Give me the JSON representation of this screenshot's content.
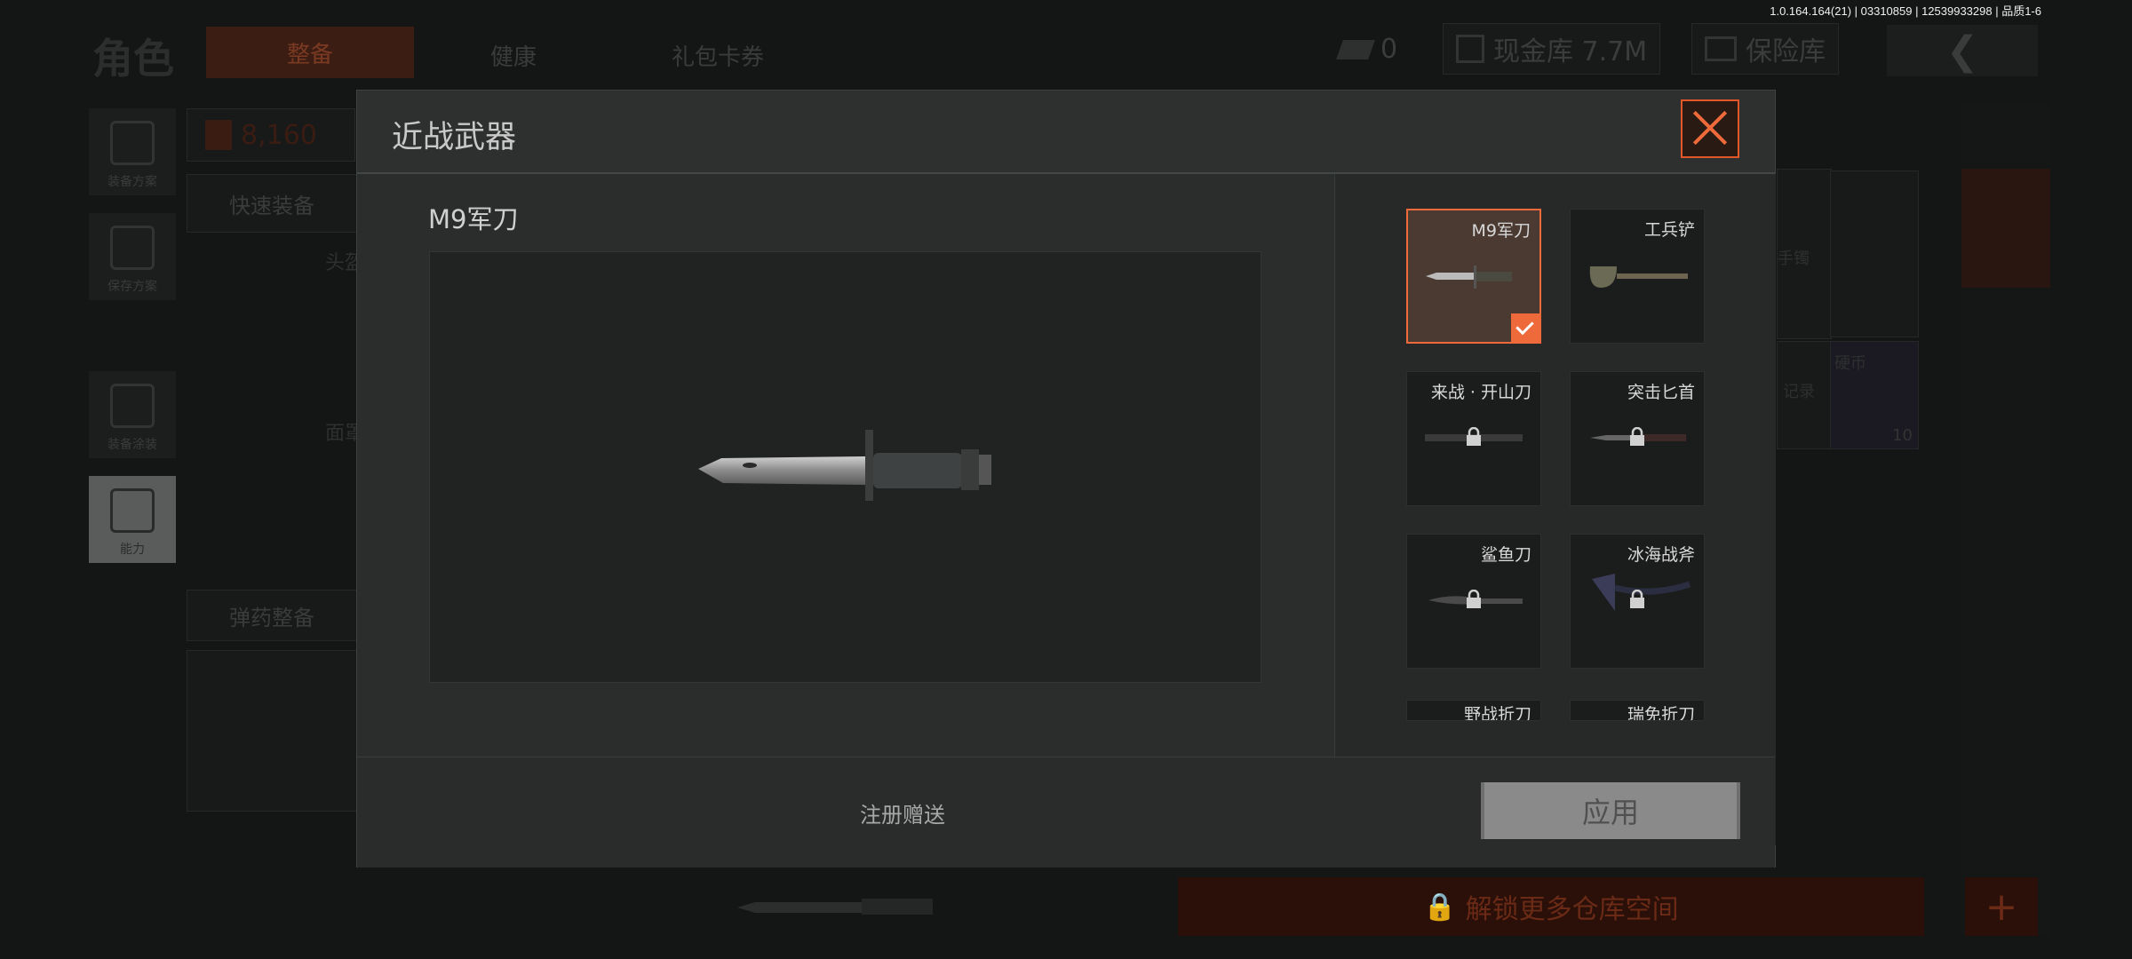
{
  "version": "1.0.164.164(21) | 03310859 | 12539933298 | 品质1-6",
  "background": {
    "title": "角色",
    "tabs": [
      "整备",
      "健康",
      "礼包卡券"
    ],
    "ticket_count": "0",
    "cash_vault": "现金库 7.7M",
    "safe_vault": "保险库",
    "armor_value": "8,160",
    "quick_equip": "快速装备",
    "ammo_equip": "弹药整备",
    "side_nav": [
      "装备方案",
      "保存方案",
      "装备涂装",
      "能力"
    ],
    "slot_labels": [
      "头盔",
      "面罩"
    ],
    "grid_labels": [
      "手镯",
      "记录",
      "硬币"
    ],
    "coin_count": "10",
    "unlock_storage": "解锁更多仓库空间",
    "plus": "+"
  },
  "modal": {
    "title": "近战武器",
    "preview_name": "M9军刀",
    "register_gift": "注册赠送",
    "apply": "应用",
    "weapons": [
      {
        "name": "M9军刀",
        "selected": true,
        "locked": false
      },
      {
        "name": "工兵铲",
        "selected": false,
        "locked": false
      },
      {
        "name": "来战 · 开山刀",
        "selected": false,
        "locked": true
      },
      {
        "name": "突击匕首",
        "selected": false,
        "locked": true
      },
      {
        "name": "鲨鱼刀",
        "selected": false,
        "locked": true
      },
      {
        "name": "冰海战斧",
        "selected": false,
        "locked": true
      },
      {
        "name": "野战折刀",
        "selected": false,
        "locked": true
      },
      {
        "name": "瑞免折刀",
        "selected": false,
        "locked": true
      }
    ]
  },
  "colors": {
    "accent": "#ef6a3a",
    "apply_bg": "#8a8a8a"
  }
}
